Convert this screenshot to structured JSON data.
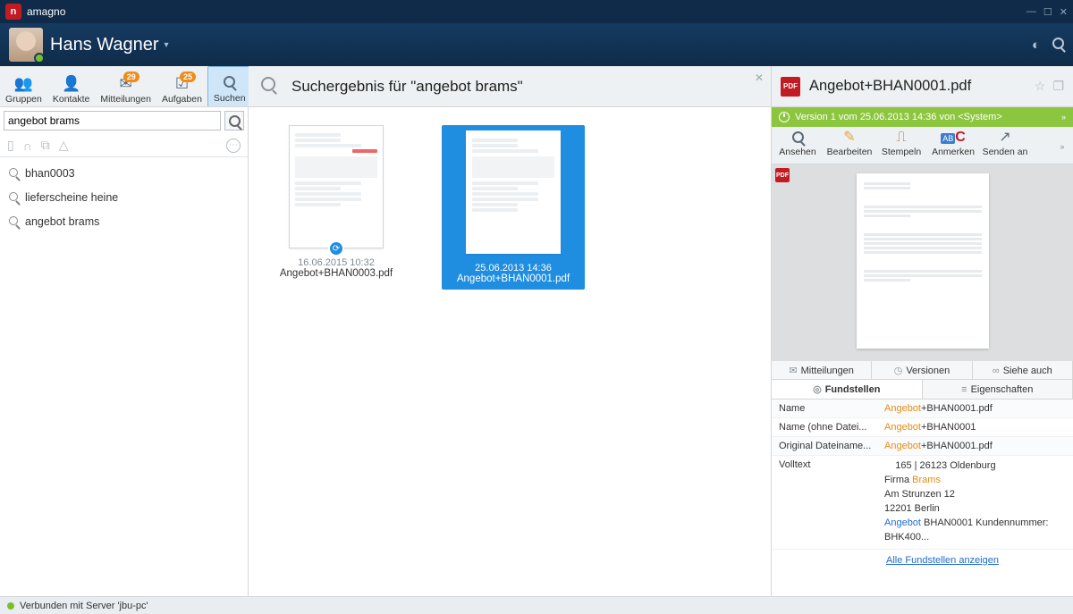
{
  "app": {
    "name": "amagno"
  },
  "user": {
    "name": "Hans Wagner"
  },
  "leftTabs": {
    "gruppen": "Gruppen",
    "kontakte": "Kontakte",
    "mitteilungen": "Mitteilungen",
    "mitteilungen_badge": "29",
    "aufgaben": "Aufgaben",
    "aufgaben_badge": "25",
    "suchen": "Suchen"
  },
  "search": {
    "query": "angebot brams"
  },
  "recent": [
    "bhan0003",
    "lieferscheine heine",
    "angebot brams"
  ],
  "center": {
    "title": "Suchergebnis für \"angebot brams\"",
    "results": [
      {
        "date": "16.06.2015 10:32",
        "name": "Angebot+BHAN0003.pdf"
      },
      {
        "date": "25.06.2013 14:36",
        "name": "Angebot+BHAN0001.pdf"
      }
    ]
  },
  "right": {
    "title": "Angebot+BHAN0001.pdf",
    "version": "Version 1 vom 25.06.2013 14:36 von <System>",
    "tools": {
      "ansehen": "Ansehen",
      "bearbeiten": "Bearbeiten",
      "stempeln": "Stempeln",
      "anmerken": "Anmerken",
      "senden": "Senden an"
    },
    "dtabs": {
      "mitteilungen": "Mitteilungen",
      "versionen": "Versionen",
      "siehe": "Siehe auch",
      "fundstellen": "Fundstellen",
      "eigenschaften": "Eigenschaften"
    },
    "props": {
      "name_k": "Name",
      "name_hl": "Angebot",
      "name_rest": "+BHAN0001.pdf",
      "noe_k": "Name (ohne Datei...",
      "noe_hl": "Angebot",
      "noe_rest": "+BHAN0001",
      "orig_k": "Original Dateiname...",
      "orig_hl": "Angebot",
      "orig_rest": "+BHAN0001.pdf",
      "voll_k": "Volltext",
      "voll_l1": "165 | 26123 Oldenburg",
      "voll_l2a": "Firma ",
      "voll_l2b": "Brams",
      "voll_l3": "Am Strunzen 12",
      "voll_l4": "12201 Berlin",
      "voll_l5a": "Angebot",
      "voll_l5b": " BHAN0001 Kundennummer: BHK400",
      "voll_ell": "..."
    },
    "alllink": "Alle Fundstellen anzeigen"
  },
  "status": "Verbunden mit Server 'jbu-pc'"
}
